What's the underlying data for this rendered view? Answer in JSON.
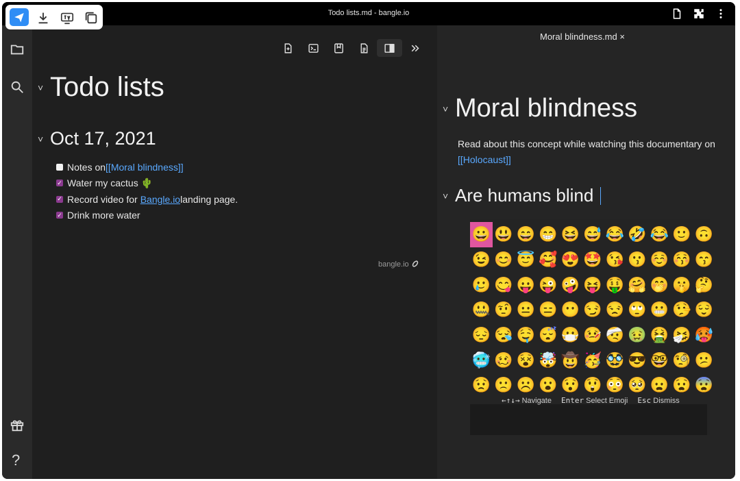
{
  "window": {
    "title": "Todo lists.md - bangle.io"
  },
  "left_pane": {
    "title": "Todo lists",
    "date_heading": "Oct 17, 2021",
    "todos": [
      {
        "checked": false,
        "prefix": "Notes on ",
        "link": "[[Moral blindness]]",
        "suffix": ""
      },
      {
        "checked": true,
        "prefix": "Water my cactus ",
        "link": "",
        "suffix": "🌵"
      },
      {
        "checked": true,
        "prefix": "Record video for ",
        "link": "Bangle.io",
        "suffix": " landing page."
      },
      {
        "checked": true,
        "prefix": "Drink more water",
        "link": "",
        "suffix": ""
      }
    ],
    "watermark": "bangle.io"
  },
  "right_pane": {
    "tab_title": "Moral blindness.md",
    "tab_close": "×",
    "title": "Moral blindness",
    "paragraph_prefix": "Read about this concept while watching this documentary on ",
    "paragraph_link": "[[Holocaust]]",
    "subheading": "Are humans blind",
    "emoji_picker": {
      "emojis": [
        "😀",
        "😃",
        "😄",
        "😁",
        "😆",
        "😅",
        "😂",
        "🤣",
        "😂",
        "🙂",
        "🙃",
        "😉",
        "😊",
        "😇",
        "🥰",
        "😍",
        "🤩",
        "😘",
        "😗",
        "☺️",
        "😚",
        "😙",
        "🥲",
        "😋",
        "😛",
        "😜",
        "🤪",
        "😝",
        "🤑",
        "🤗",
        "🤭",
        "🤫",
        "🤔",
        "🤐",
        "🤨",
        "😐",
        "😑",
        "😶",
        "😏",
        "😒",
        "🙄",
        "😬",
        "🤥",
        "😌",
        "😔",
        "😪",
        "🤤",
        "😴",
        "😷",
        "🤒",
        "🤕",
        "🤢",
        "🤮",
        "🤧",
        "🥵",
        "🥶",
        "🥴",
        "😵",
        "🤯",
        "🤠",
        "🥳",
        "🥸",
        "😎",
        "🤓",
        "🧐",
        "😕",
        "😟",
        "🙁",
        "☹️",
        "😮",
        "😯",
        "😲",
        "😳",
        "🥺",
        "😦",
        "😧",
        "😨"
      ],
      "selected_index": 0,
      "help": [
        {
          "key": "←↑↓→",
          "label": "Navigate"
        },
        {
          "key": "Enter",
          "label": "Select Emoji"
        },
        {
          "key": "Esc",
          "label": "Dismiss"
        }
      ]
    }
  }
}
